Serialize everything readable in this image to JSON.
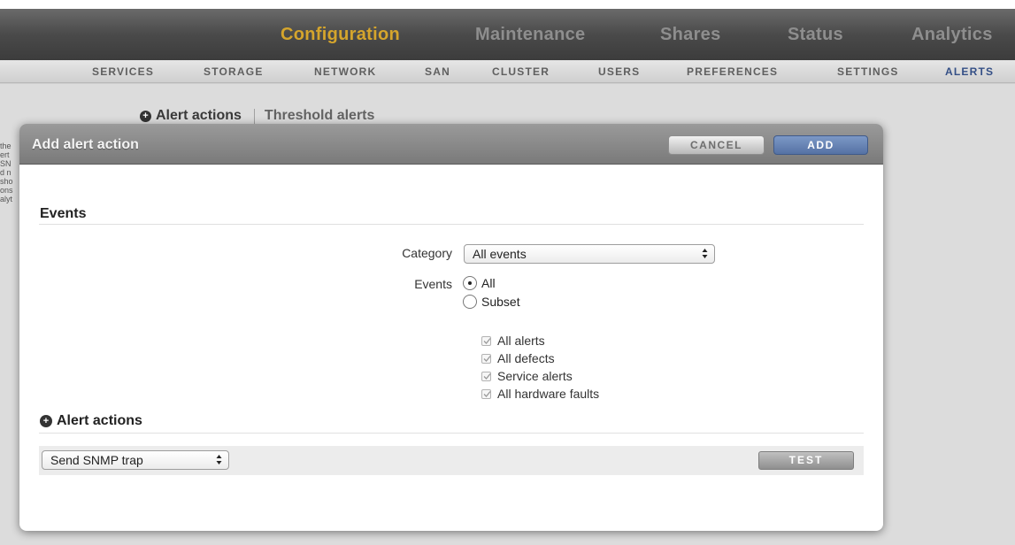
{
  "nav": {
    "main_tabs": [
      {
        "label": "Configuration",
        "active": true
      },
      {
        "label": "Maintenance",
        "active": false
      },
      {
        "label": "Shares",
        "active": false
      },
      {
        "label": "Status",
        "active": false
      },
      {
        "label": "Analytics",
        "active": false
      }
    ],
    "sub_tabs": [
      {
        "label": "SERVICES",
        "active": false
      },
      {
        "label": "STORAGE",
        "active": false
      },
      {
        "label": "NETWORK",
        "active": false
      },
      {
        "label": "SAN",
        "active": false
      },
      {
        "label": "CLUSTER",
        "active": false
      },
      {
        "label": "USERS",
        "active": false
      },
      {
        "label": "PREFERENCES",
        "active": false
      },
      {
        "label": "SETTINGS",
        "active": false
      },
      {
        "label": "ALERTS",
        "active": true
      }
    ]
  },
  "page": {
    "alert_actions_link": "Alert actions",
    "threshold_alerts_link": "Threshold alerts",
    "side_snippets": [
      "the",
      "ert",
      "SN",
      "d n",
      "sho",
      "ons",
      "alyt"
    ]
  },
  "dialog": {
    "title": "Add alert action",
    "cancel_label": "CANCEL",
    "add_label": "ADD",
    "events_section": {
      "title": "Events",
      "category_label": "Category",
      "category_value": "All events",
      "events_label": "Events",
      "radio_all": "All",
      "radio_subset": "Subset",
      "selected": "All",
      "checkboxes": [
        {
          "label": "All alerts",
          "checked": true
        },
        {
          "label": "All defects",
          "checked": true
        },
        {
          "label": "Service alerts",
          "checked": true
        },
        {
          "label": "All hardware faults",
          "checked": true
        }
      ]
    },
    "actions_section": {
      "title": "Alert actions",
      "action_value": "Send SNMP trap",
      "test_label": "TEST"
    }
  },
  "colors": {
    "active_main_tab": "#d5a52c",
    "active_sub_tab": "#344f86",
    "add_button": "#5572a4"
  }
}
